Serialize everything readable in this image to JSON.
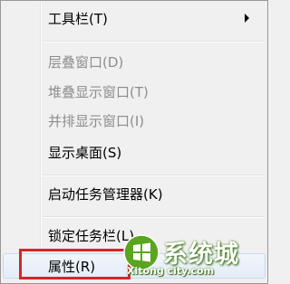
{
  "context_menu": {
    "items": [
      {
        "label": "工具栏(T)",
        "enabled": true,
        "has_submenu": true
      },
      {
        "label": "层叠窗口(D)",
        "enabled": false
      },
      {
        "label": "堆叠显示窗口(T)",
        "enabled": false
      },
      {
        "label": "并排显示窗口(I)",
        "enabled": false
      },
      {
        "label": "显示桌面(S)",
        "enabled": true
      },
      {
        "label": "启动任务管理器(K)",
        "enabled": true
      },
      {
        "label": "锁定任务栏(L)",
        "enabled": true
      },
      {
        "label": "属性(R)",
        "enabled": true,
        "highlighted": true
      }
    ],
    "highlight_color": "#d6252c"
  },
  "watermark": {
    "title": "系统城",
    "url": "Xitong city.com"
  }
}
